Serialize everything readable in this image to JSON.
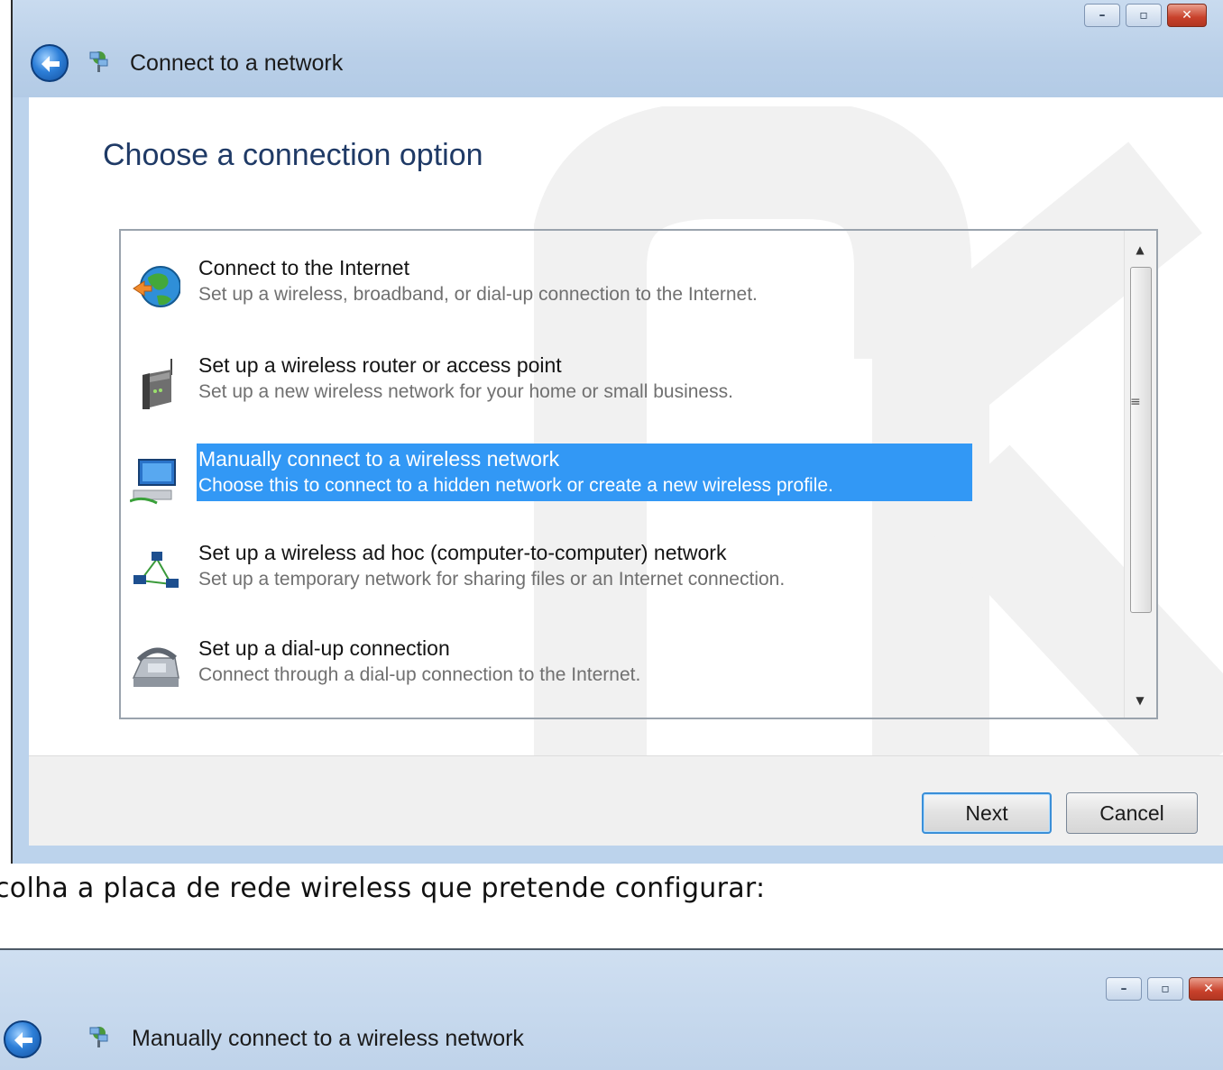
{
  "window1": {
    "title": "Connect to a network",
    "heading": "Choose a connection option",
    "options": [
      {
        "title": "Connect to the Internet",
        "description": "Set up a wireless, broadband, or dial-up connection to the Internet.",
        "icon": "globe-icon",
        "selected": false
      },
      {
        "title": "Set up a wireless router or access point",
        "description": "Set up a new wireless network for your home or small business.",
        "icon": "router-icon",
        "selected": false
      },
      {
        "title": "Manually connect to a wireless network",
        "description": "Choose this to connect to a hidden network or create a new wireless profile.",
        "icon": "computer-network-icon",
        "selected": true
      },
      {
        "title": "Set up a wireless ad hoc (computer-to-computer) network",
        "description": "Set up a temporary network for sharing files or an Internet connection.",
        "icon": "adhoc-network-icon",
        "selected": false
      },
      {
        "title": "Set up a dial-up connection",
        "description": "Connect through a dial-up connection to the Internet.",
        "icon": "phone-icon",
        "selected": false
      }
    ],
    "next_label": "Next",
    "cancel_label": "Cancel"
  },
  "caption": "colha a placa de rede wireless que pretende configurar:",
  "window2": {
    "title": "Manually connect to a wireless network"
  },
  "colors": {
    "selection": "#3298f5",
    "heading": "#1f3a66",
    "titlebar": "#bcd3ec"
  }
}
